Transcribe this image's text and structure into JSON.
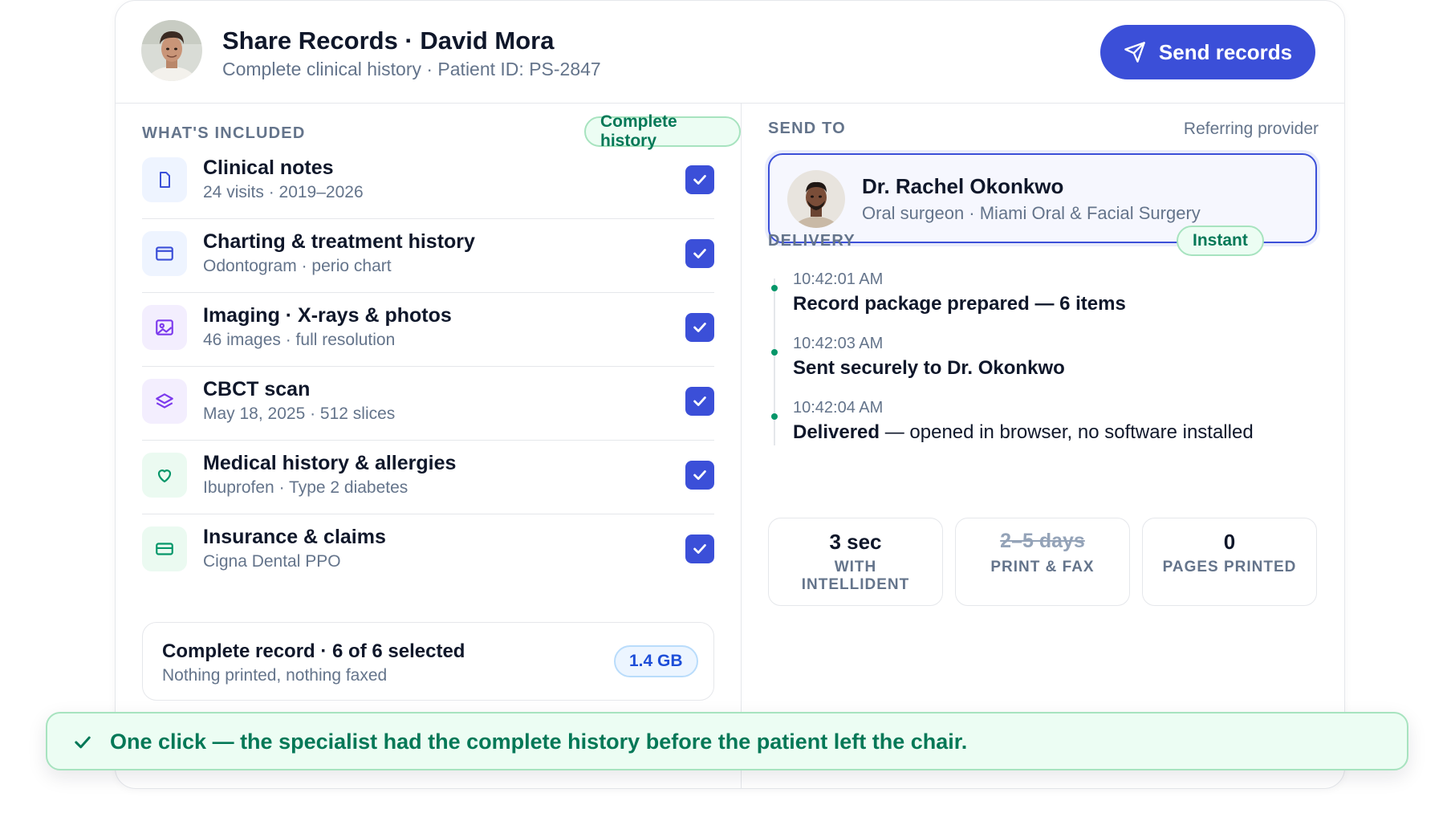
{
  "header": {
    "title": "Share Records · David Mora",
    "subtitle": "Complete clinical history · Patient ID: PS-2847",
    "send_button": "Send records"
  },
  "included": {
    "label": "WHAT'S INCLUDED",
    "badge": "Complete history",
    "items": [
      {
        "title": "Clinical notes",
        "sub": "24 visits · 2019–2026",
        "icon": "document-icon",
        "checked": true
      },
      {
        "title": "Charting & treatment history",
        "sub": "Odontogram · perio chart",
        "icon": "chart-window-icon",
        "checked": true
      },
      {
        "title": "Imaging · X-rays & photos",
        "sub": "46 images · full resolution",
        "icon": "image-icon",
        "checked": true
      },
      {
        "title": "CBCT scan",
        "sub": "May 18, 2025 · 512 slices",
        "icon": "layers-icon",
        "checked": true
      },
      {
        "title": "Medical history & allergies",
        "sub": "Ibuprofen · Type 2 diabetes",
        "icon": "heart-icon",
        "checked": true
      },
      {
        "title": "Insurance & claims",
        "sub": "Cigna Dental PPO",
        "icon": "credit-card-icon",
        "checked": true
      }
    ],
    "summary": {
      "title": "Complete record · 6 of 6 selected",
      "sub": "Nothing printed, nothing faxed",
      "size": "1.4 GB"
    }
  },
  "send_to": {
    "label": "SEND TO",
    "hint": "Referring provider",
    "recipient": {
      "name": "Dr. Rachel Okonkwo",
      "sub": "Oral surgeon · Miami Oral & Facial Surgery"
    }
  },
  "delivery": {
    "label": "DELIVERY",
    "badge": "Instant",
    "events": [
      {
        "time": "10:42:01 AM",
        "text": "Record package prepared — 6 items"
      },
      {
        "time": "10:42:03 AM",
        "text": "Sent securely to Dr. Okonkwo"
      },
      {
        "time": "10:42:04 AM",
        "text_bold": "Delivered",
        "text_rest": " — opened in browser, no software installed"
      }
    ],
    "stats": [
      {
        "value": "3 sec",
        "label_1": "WITH",
        "label_2": "INTELLIDENT"
      },
      {
        "value": "2–5 days",
        "label_1": "PRINT & FAX"
      },
      {
        "value": "0",
        "label_1": "PAGES PRINTED"
      }
    ]
  },
  "toast": {
    "text": "One click — the specialist had the complete history before the patient left the chair."
  },
  "colors": {
    "accent": "#3b4fd8",
    "success": "#047857",
    "muted": "#64748b"
  }
}
